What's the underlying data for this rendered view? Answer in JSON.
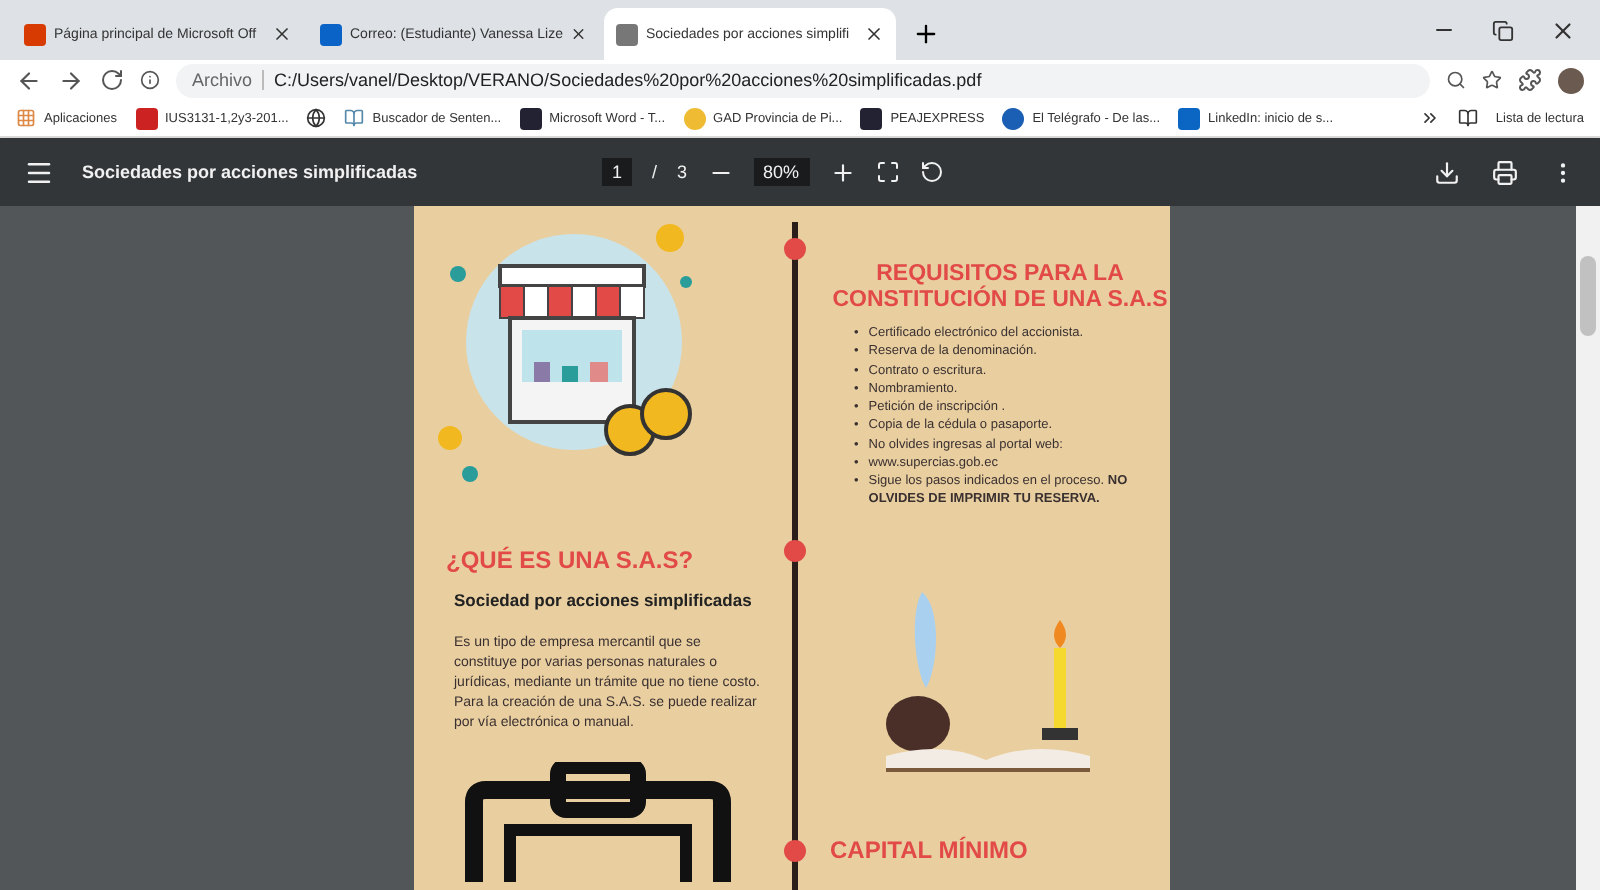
{
  "tabs": [
    {
      "title": "Página principal de Microsoft Off",
      "kind": "office",
      "selected": false
    },
    {
      "title": "Correo: (Estudiante) Vanessa Lize",
      "kind": "outlook",
      "selected": false
    },
    {
      "title": "Sociedades por acciones simplifi",
      "kind": "globe",
      "selected": true
    }
  ],
  "address_bar": {
    "scheme": "Archivo",
    "url": "C:/Users/vanel/Desktop/VERANO/Sociedades%20por%20acciones%20simplificadas.pdf"
  },
  "bookmarks": [
    {
      "label": "Aplicaciones",
      "kind": "apps"
    },
    {
      "label": "IUS3131-1,2y3-201...",
      "kind": "red"
    },
    {
      "kind": "globe"
    },
    {
      "label": "Buscador de Senten...",
      "kind": "doc"
    },
    {
      "label": "Microsoft Word - T...",
      "kind": "dark"
    },
    {
      "label": "GAD Provincia de Pi...",
      "kind": "yellow"
    },
    {
      "label": "PEAJEXPRESS",
      "kind": "dark"
    },
    {
      "label": "El Telégrafo - De las...",
      "kind": "blue"
    },
    {
      "label": "LinkedIn: inicio de s...",
      "kind": "linkedin"
    }
  ],
  "reading_list": "Lista de lectura",
  "pdf_toolbar": {
    "title": "Sociedades por acciones simplificadas",
    "page": "1",
    "separator": "/",
    "pages": "3",
    "zoom": "80%"
  },
  "document": {
    "requirements_title": "REQUISITOS PARA LA CONSTITUCIÓN DE UNA S.A.S",
    "bullet": "•",
    "requirements": [
      "Certificado electrónico del accionista.",
      "Reserva de la denominación.",
      "Contrato o escritura.",
      "Nombramiento.",
      "Petición de inscripción .",
      "Copia de la cédula o pasaporte.",
      "No olvides ingresas al portal web:",
      "www.supercias.gob.ec",
      "Sigue los pasos indicados en el proceso. **NO OLVIDES DE IMPRIMIR TU RESERVA.**"
    ],
    "what_title": "¿QUÉ ES UNA S.A.S?",
    "what_subtitle": "Sociedad por acciones simplificadas",
    "what_text": [
      "Es un tipo de empresa mercantil que se constituye por varias personas naturales o jurídicas, mediante un trámite que no tiene costo.",
      "Para la creación de una S.A.S. se puede realizar por vía electrónica o manual."
    ],
    "capital_title": "CAPITAL MÍNIMO"
  }
}
